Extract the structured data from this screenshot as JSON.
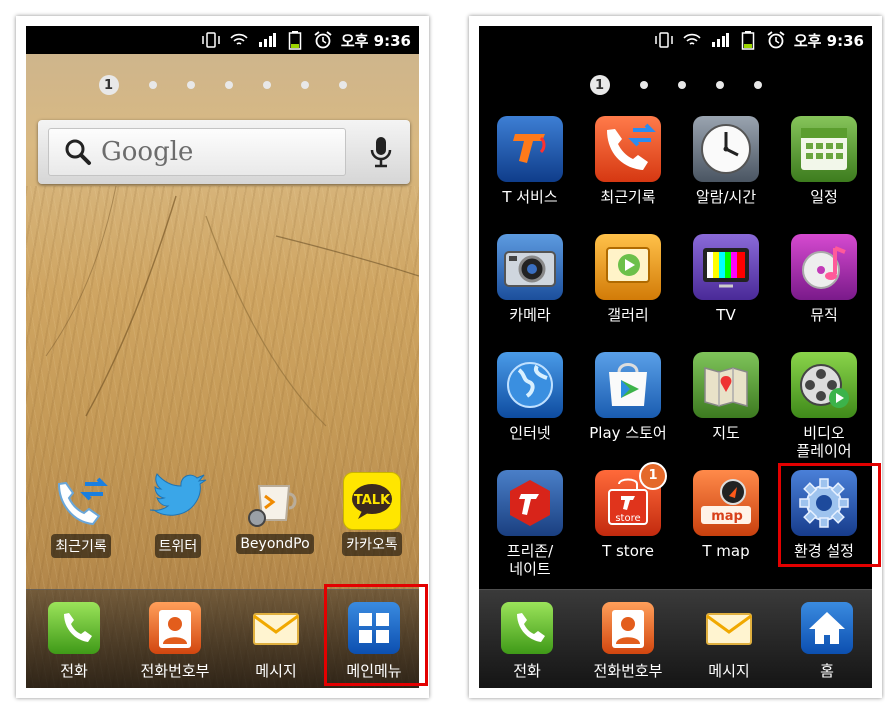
{
  "left_screen": {
    "status_time": "오후 9:36",
    "page_indicator": {
      "current": "1",
      "count": 7
    },
    "google_label": "Google",
    "shortcuts": [
      {
        "label": "최근기록",
        "icon": "recent-calls-icon"
      },
      {
        "label": "트위터",
        "icon": "twitter-bird-icon"
      },
      {
        "label": "BeyondPo",
        "icon": "beyondpod-icon"
      },
      {
        "label": "카카오톡",
        "icon": "kakaotalk-icon"
      }
    ],
    "dock": [
      {
        "label": "전화",
        "icon": "phone-icon"
      },
      {
        "label": "전화번호부",
        "icon": "contacts-icon"
      },
      {
        "label": "메시지",
        "icon": "message-icon"
      },
      {
        "label": "메인메뉴",
        "icon": "app-grid-icon"
      }
    ]
  },
  "right_screen": {
    "status_time": "오후 9:36",
    "page_indicator": {
      "current": "1",
      "count": 5
    },
    "apps": [
      {
        "label": "T 서비스",
        "icon": "t-service-icon"
      },
      {
        "label": "최근기록",
        "icon": "recent-calls-icon"
      },
      {
        "label": "알람/시간",
        "icon": "clock-icon"
      },
      {
        "label": "일정",
        "icon": "calendar-icon"
      },
      {
        "label": "카메라",
        "icon": "camera-icon"
      },
      {
        "label": "갤러리",
        "icon": "gallery-icon"
      },
      {
        "label": "TV",
        "icon": "tv-icon"
      },
      {
        "label": "뮤직",
        "icon": "music-icon"
      },
      {
        "label": "인터넷",
        "icon": "globe-icon"
      },
      {
        "label": "Play 스토어",
        "icon": "play-store-icon"
      },
      {
        "label": "지도",
        "icon": "map-icon"
      },
      {
        "label": "비디오\n플레이어",
        "icon": "video-player-icon"
      },
      {
        "label": "프리존/\n네이트",
        "icon": "freezone-icon"
      },
      {
        "label": "T store",
        "icon": "t-store-icon",
        "badge": "1"
      },
      {
        "label": "T map",
        "icon": "t-map-icon"
      },
      {
        "label": "환경 설정",
        "icon": "settings-gear-icon"
      }
    ],
    "dock": [
      {
        "label": "전화",
        "icon": "phone-icon"
      },
      {
        "label": "전화번호부",
        "icon": "contacts-icon"
      },
      {
        "label": "메시지",
        "icon": "message-icon"
      },
      {
        "label": "홈",
        "icon": "home-icon"
      }
    ]
  },
  "colors": {
    "highlight": "#e30000",
    "status_bar": "#000000"
  }
}
